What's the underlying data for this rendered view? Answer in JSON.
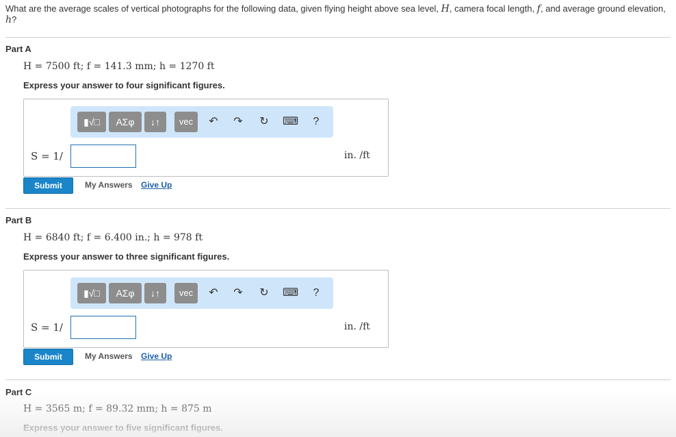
{
  "question": {
    "text_before": "What are the average scales of vertical photographs for the following data, given flying height above sea level, ",
    "var_H": "H",
    "text_mid1": ", camera focal length, ",
    "var_f": "f",
    "text_mid2": ", and average ground elevation, ",
    "var_h": "h",
    "text_end": "?"
  },
  "toolbar": {
    "templates_label": "▮√□",
    "greek_label": "ΑΣφ",
    "arrows_label": "↓↑",
    "vec_label": "vec",
    "undo_glyph": "↶",
    "redo_glyph": "↷",
    "reset_glyph": "↻",
    "keyboard_glyph": "⌨",
    "help_glyph": "?"
  },
  "answer_prefix": "S = 1/",
  "unit_label": "in. /ft",
  "actions": {
    "submit": "Submit",
    "my_answers": "My Answers",
    "give_up": "Give Up"
  },
  "parts": [
    {
      "title": "Part A",
      "given": "H = 7500 ft; f = 141.3 mm; h = 1270 ft",
      "instruction": "Express your answer to four significant figures."
    },
    {
      "title": "Part B",
      "given": "H = 6840 ft; f = 6.400 in.; h = 978 ft",
      "instruction": "Express your answer to three significant figures."
    },
    {
      "title": "Part C",
      "given": "H = 3565 m; f = 89.32 mm; h = 875 m",
      "instruction": "Express your answer to five significant figures."
    }
  ],
  "colors": {
    "submit_bg": "#1a85c9",
    "toolbar_bg": "#cfe6fa",
    "link": "#1b5fa8"
  }
}
